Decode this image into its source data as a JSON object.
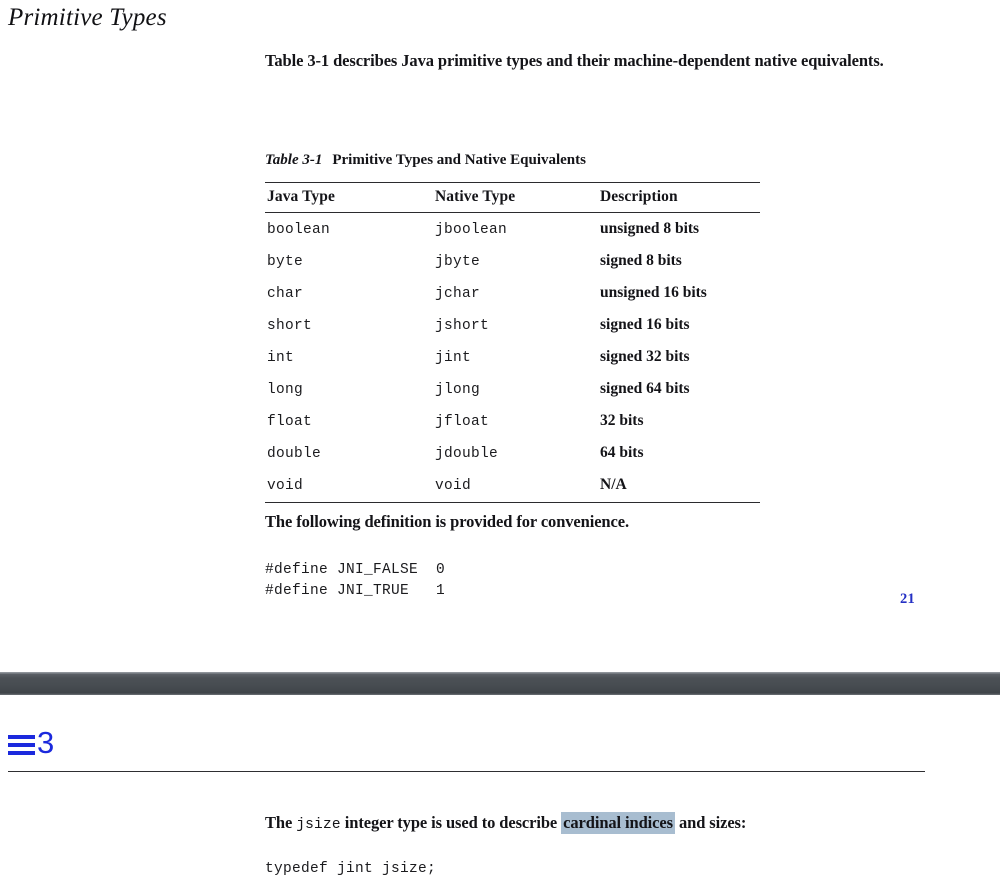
{
  "page_top": {
    "chapter_heading": "Primitive Types",
    "intro_paragraph": "Table 3-1 describes Java primitive types and their machine-dependent native equivalents.",
    "table": {
      "caption_label": "Table 3-1",
      "caption_title": "Primitive Types and Native Equivalents",
      "columns": [
        "Java Type",
        "Native Type",
        "Description"
      ],
      "rows": [
        [
          "boolean",
          "jboolean",
          "unsigned 8 bits"
        ],
        [
          "byte",
          "jbyte",
          "signed 8 bits"
        ],
        [
          "char",
          "jchar",
          "unsigned 16 bits"
        ],
        [
          "short",
          "jshort",
          "signed 16 bits"
        ],
        [
          "int",
          "jint",
          "signed 32 bits"
        ],
        [
          "long",
          "jlong",
          "signed 64 bits"
        ],
        [
          "float",
          "jfloat",
          "32 bits"
        ],
        [
          "double",
          "jdouble",
          "64 bits"
        ],
        [
          "void",
          "void",
          "N/A"
        ]
      ]
    },
    "after_table_text": "The following definition is provided for convenience.",
    "code_block": "#define JNI_FALSE  0\n#define JNI_TRUE   1",
    "page_number": "21",
    "page_number_color": "#2430c4"
  },
  "divider": {
    "color": "#4a4f54"
  },
  "page_bottom": {
    "chapter_number": "3",
    "menu_icon": "hamburger-icon",
    "accent_color": "#1b29dd",
    "paragraph": {
      "before_code": "The ",
      "code": "jsize",
      "after_code": " integer type is used to describe ",
      "highlighted": "cardinal indices",
      "tail": " and sizes:",
      "highlight_color": "#a8bdd0"
    },
    "code_typedef": "typedef jint jsize;"
  }
}
